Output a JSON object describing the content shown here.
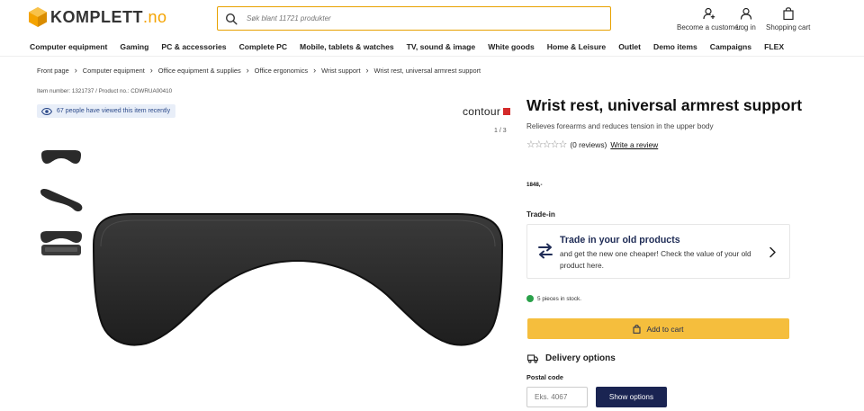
{
  "header": {
    "logo_text": "KOMPLETT",
    "logo_tld": ".no",
    "search_placeholder": "Søk blant 11721 produkter",
    "become_customer": "Become a customer",
    "log_in": "Log in",
    "shopping_cart": "Shopping cart"
  },
  "categories": [
    "Computer equipment",
    "Gaming",
    "PC & accessories",
    "Complete PC",
    "Mobile, tablets & watches",
    "TV, sound & image",
    "White goods",
    "Home & Leisure",
    "Outlet",
    "Demo items",
    "Campaigns",
    "FLEX"
  ],
  "breadcrumb": [
    "Front page",
    "Computer equipment",
    "Office equipment & supplies",
    "Office ergonomics",
    "Wrist support",
    "Wrist rest, universal armrest support"
  ],
  "product": {
    "item_number_text": "Item number: 1321737 / Product no.: CDWRUA00410",
    "viewed_text": "67 people have viewed this item recently",
    "brand": "contour",
    "image_counter": "1 / 3",
    "title": "Wrist rest, universal armrest support",
    "subtitle": "Relieves forearms and reduces tension in the upper body",
    "stars_filled": 0,
    "stars_total": 5,
    "reviews_count_text": "(0 reviews)",
    "write_review": "Write a review",
    "price": "1848,-"
  },
  "tradein": {
    "label": "Trade-in",
    "title": "Trade in your old products",
    "text": "and get the new one cheaper! Check the value of your old product here."
  },
  "stock": {
    "text": "5 pieces in stock.",
    "status_color": "#2aa14a"
  },
  "actions": {
    "add_to_cart": "Add to cart",
    "delivery_options": "Delivery options",
    "postal_code_label": "Postal code",
    "postal_code_placeholder": "Eks. 4067",
    "show_options": "Show options"
  },
  "colors": {
    "accent": "#f5be3d",
    "navy": "#1a2452",
    "brand_red": "#d42a2a"
  }
}
